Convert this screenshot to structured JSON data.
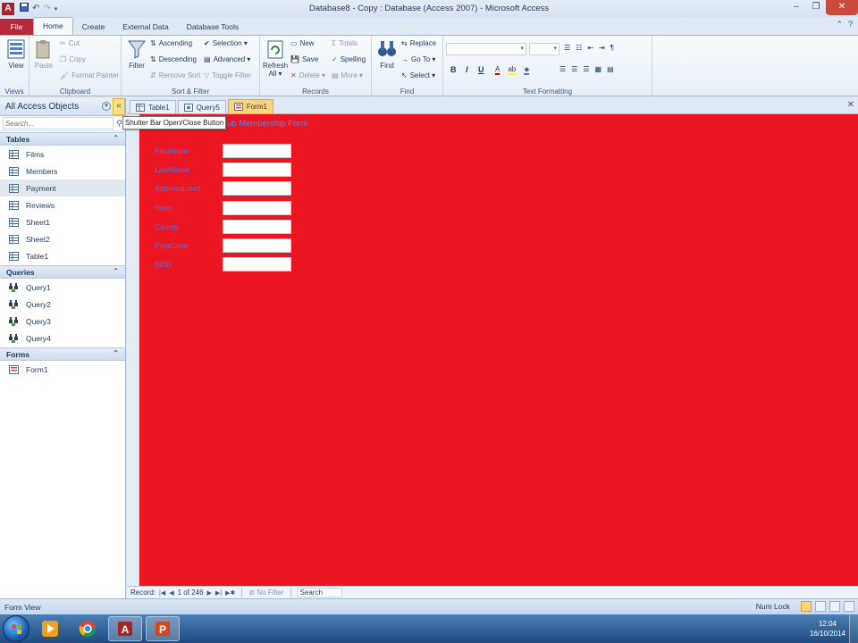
{
  "window": {
    "title": "Database8 - Copy : Database (Access 2007) - Microsoft Access",
    "app_icon": "A",
    "controls": [
      "minimize-icon",
      "maximize-icon",
      "close-icon"
    ]
  },
  "ribbon": {
    "tabs": [
      "File",
      "Home",
      "Create",
      "External Data",
      "Database Tools"
    ],
    "active_tab": "Home",
    "groups": {
      "views": {
        "label": "Views",
        "view": "View"
      },
      "clipboard": {
        "label": "Clipboard",
        "paste": "Paste",
        "cut": "Cut",
        "copy": "Copy",
        "format_painter": "Format Painter"
      },
      "sort_filter": {
        "label": "Sort & Filter",
        "filter": "Filter",
        "ascending": "Ascending",
        "descending": "Descending",
        "remove_sort": "Remove Sort",
        "selection": "Selection ▾",
        "advanced": "Advanced ▾",
        "toggle_filter": "Toggle Filter"
      },
      "records": {
        "label": "Records",
        "refresh": "Refresh",
        "refresh_all": "All ▾",
        "new": "New",
        "save": "Save",
        "delete": "Delete ▾",
        "totals": "Totals",
        "spelling": "Spelling",
        "more": "More ▾"
      },
      "find": {
        "label": "Find",
        "find": "Find",
        "replace": "Replace",
        "goto": "Go To ▾",
        "select": "Select ▾"
      },
      "text_formatting": {
        "label": "Text Formatting",
        "bold": "B",
        "italic": "I",
        "underline": "U"
      }
    }
  },
  "nav_pane": {
    "title": "All Access Objects",
    "shutter_glyph": "«",
    "search_placeholder": "Search...",
    "sections": {
      "tables": {
        "label": "Tables",
        "items": [
          "Films",
          "Members",
          "Payment",
          "Reviews",
          "Sheet1",
          "Sheet2",
          "Table1"
        ],
        "selected": "Payment"
      },
      "queries": {
        "label": "Queries",
        "items": [
          "Query1",
          "Query2",
          "Query3",
          "Query4"
        ]
      },
      "forms": {
        "label": "Forms",
        "items": [
          "Form1"
        ]
      }
    }
  },
  "documents": {
    "tabs": [
      "Table1",
      "Query5",
      "Form1"
    ],
    "active": "Form1"
  },
  "tooltip": "Shutter Bar Open/Close Button",
  "form": {
    "title_partial": "lub Membership Form",
    "background": "#ec1622",
    "label_color": "#5a6fd6",
    "fields": [
      {
        "label": "FirstName",
        "value": ""
      },
      {
        "label": "LastName",
        "value": ""
      },
      {
        "label": "AddressLine1",
        "value": ""
      },
      {
        "label": "Town",
        "value": ""
      },
      {
        "label": "County",
        "value": ""
      },
      {
        "label": "PostCode",
        "value": ""
      },
      {
        "label": "DOB",
        "value": ""
      }
    ]
  },
  "record_nav": {
    "label": "Record:",
    "position": "1 of 246",
    "filter": "No Filter",
    "search": "Search"
  },
  "status_bar": {
    "left": "Form View",
    "num_lock": "Num Lock"
  },
  "taskbar": {
    "time": "12:04",
    "date": "16/10/2014"
  }
}
